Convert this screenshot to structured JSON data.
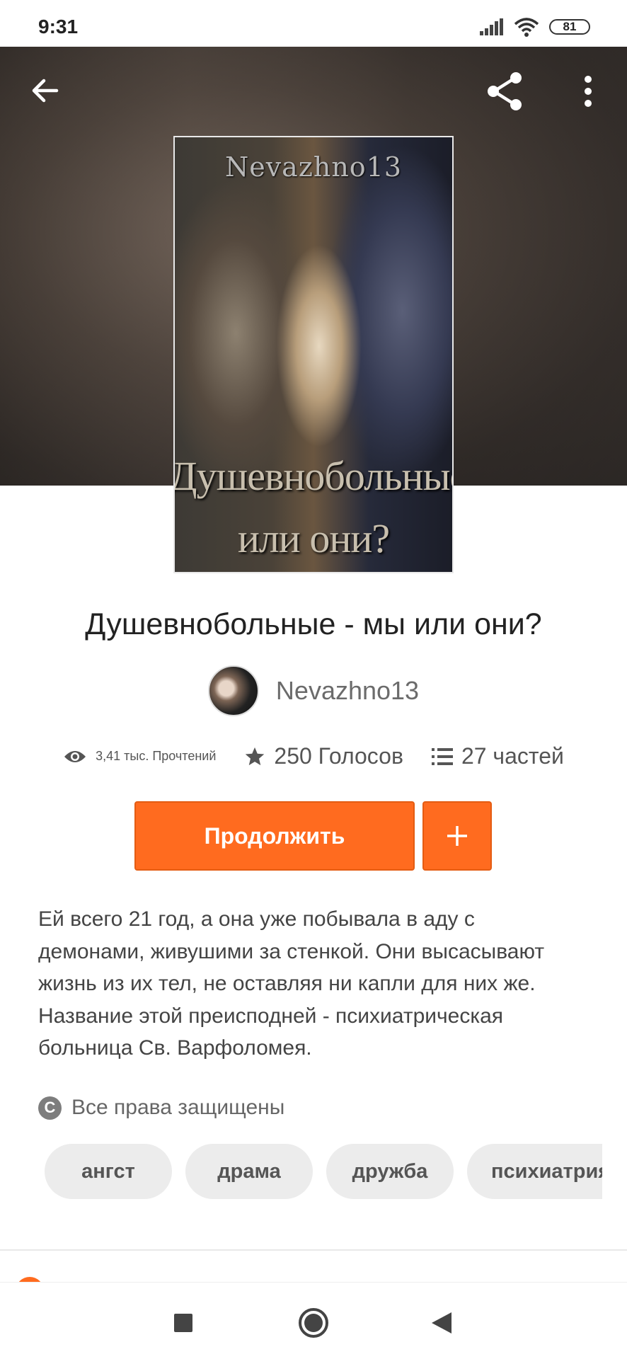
{
  "status_bar": {
    "time": "9:31",
    "battery": "81",
    "icons": [
      "signal-icon",
      "wifi-icon",
      "battery-icon"
    ]
  },
  "header": {
    "back_icon": "back-arrow-icon",
    "share_icon": "share-icon",
    "more_icon": "more-vert-icon"
  },
  "cover": {
    "author_text": "Nevazhno13",
    "title_line1": "Душевнобольные - мы",
    "title_line2": "или они?"
  },
  "story": {
    "title": "Душевнобольные - мы или они?",
    "author": "Nevazhno13",
    "stats": {
      "reads": "3,41 тыс. Прочтений",
      "votes": "250 Голосов",
      "parts": "27 частей"
    },
    "continue_label": "Продолжить",
    "add_label": "+",
    "description": "Ей всего 21 год, а она уже побывала в аду с\nдемонами, живушими за стенкой. Они высасывают\nжизнь из их тел, не оставляя ни капли для них же.\nНазвание этой преисподней  - психиатрическая\nбольница  Св. Варфоломея.",
    "copyright_symbol": "C",
    "copyright": "Все права защищены",
    "tags": [
      "ангст",
      "драма",
      "дружба",
      "психиатрия"
    ]
  },
  "colors": {
    "accent": "#ff6b1f",
    "tag_bg": "#ececec"
  },
  "nav": [
    "recents-button",
    "home-button",
    "back-button"
  ]
}
